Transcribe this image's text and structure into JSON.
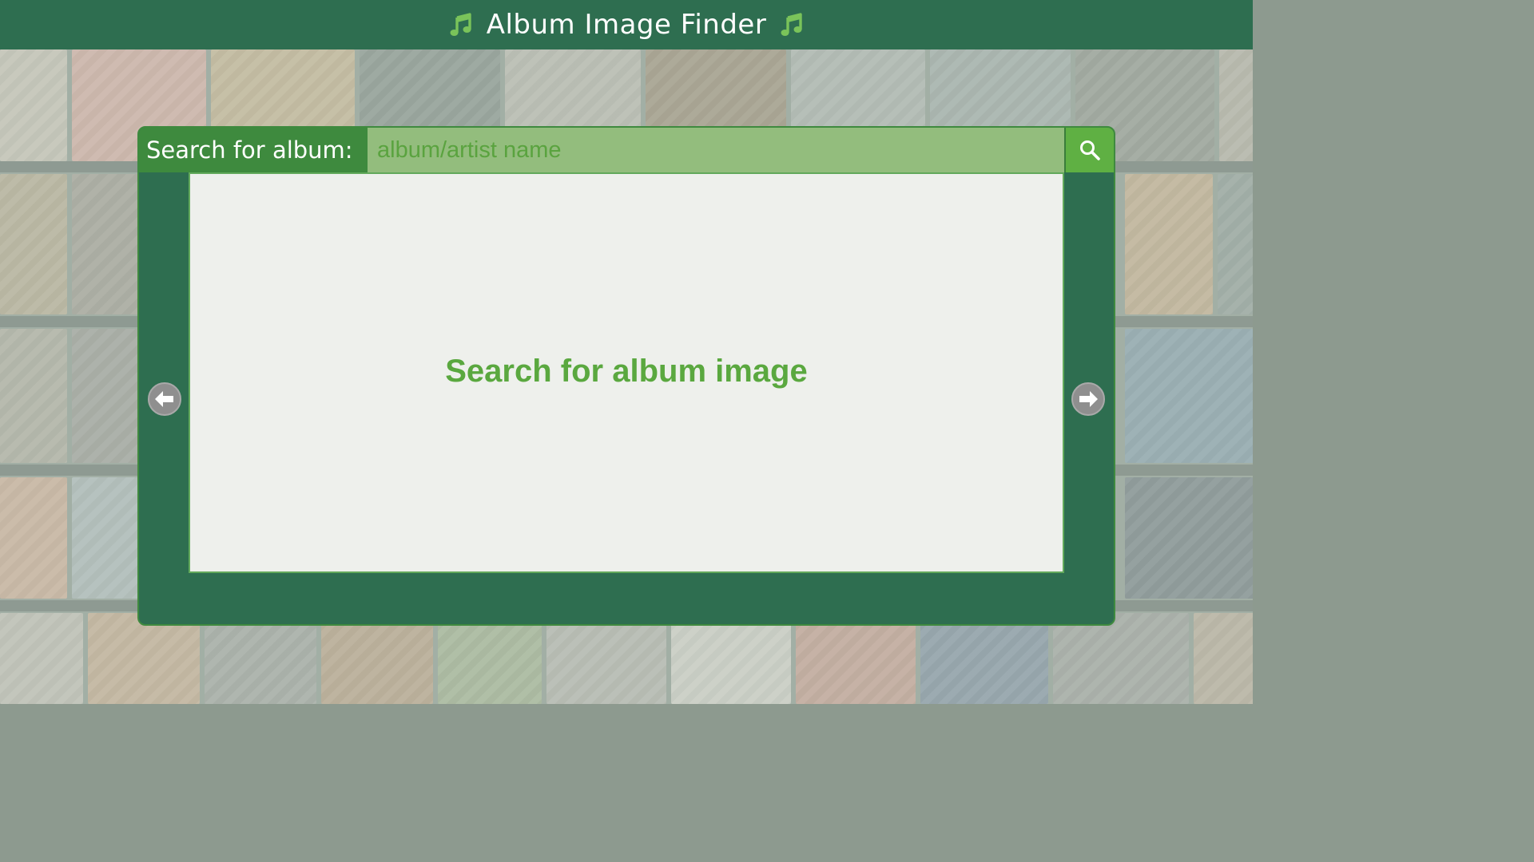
{
  "header": {
    "title": "Album Image Finder",
    "left_icon": "music-note-icon",
    "right_icon": "music-note-icon"
  },
  "search": {
    "label": "Search for album:",
    "placeholder": "album/artist name",
    "value": "",
    "button_icon": "search-icon"
  },
  "viewer": {
    "empty_message": "Search for album image",
    "prev_icon": "arrow-left-icon",
    "next_icon": "arrow-right-icon"
  },
  "colors": {
    "header_bg": "#2e6e50",
    "panel_bg": "#2e6e50",
    "accent_green": "#5fb043",
    "input_bg": "#93bd7d",
    "message_text": "#5aa83f",
    "viewer_bg": "#eef0ec"
  }
}
